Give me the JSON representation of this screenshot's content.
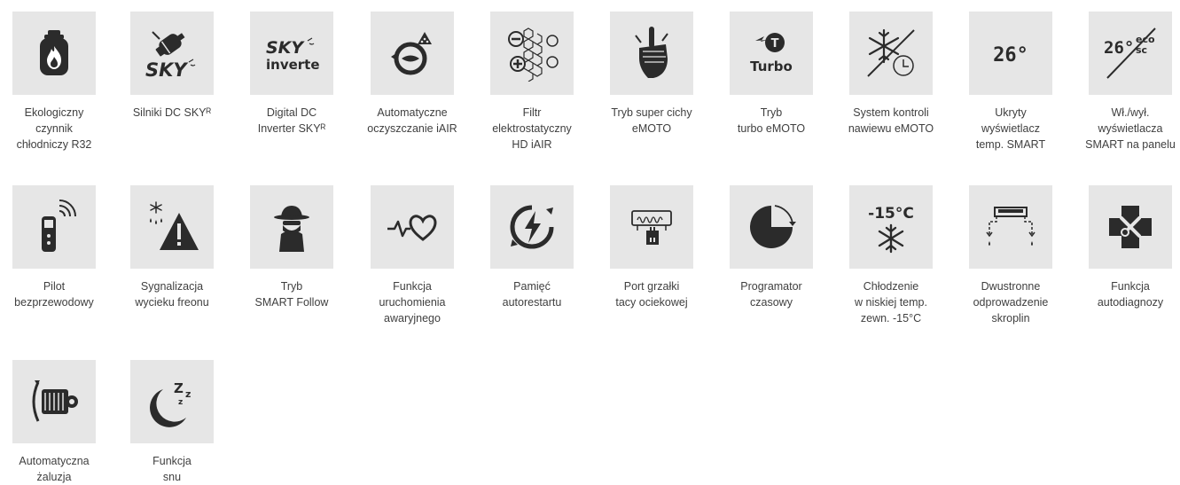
{
  "features": [
    {
      "icon": "gas-cylinder-flame-icon",
      "lines": [
        "Ekologiczny",
        "czynnik",
        "chłodniczy R32"
      ]
    },
    {
      "icon": "sky-dc-motor-icon",
      "lines": [
        "Silniki DC SKYᴿ"
      ],
      "icon_text": "SKY"
    },
    {
      "icon": "sky-inverter-icon",
      "lines": [
        "Digital DC",
        "Inverter SKYᴿ"
      ],
      "icon_text_1": "SKY",
      "icon_text_2": "inverter"
    },
    {
      "icon": "iair-self-cleaning-icon",
      "lines": [
        "Automatyczne",
        "oczyszczanie iAIR"
      ]
    },
    {
      "icon": "electrostatic-filter-icon",
      "lines": [
        "Filtr",
        "elektrostatyczny",
        "HD iAIR"
      ]
    },
    {
      "icon": "silent-hand-icon",
      "lines": [
        "Tryb super cichy",
        "eMOTO"
      ]
    },
    {
      "icon": "turbo-mode-icon",
      "lines": [
        "Tryb",
        "turbo eMOTO"
      ],
      "icon_text_1": "T",
      "icon_text_2": "Turbo"
    },
    {
      "icon": "snowflake-clock-icon",
      "lines": [
        "System kontroli",
        "nawiewu eMOTO"
      ]
    },
    {
      "icon": "hidden-display-icon",
      "lines": [
        "Ukryty",
        "wyświetlacz",
        "temp. SMART"
      ],
      "icon_text": "26°"
    },
    {
      "icon": "display-on-off-icon",
      "lines": [
        "Wł./wył.",
        "wyświetlacza",
        "SMART na panelu"
      ],
      "icon_text_1": "26°",
      "icon_text_2": "eco",
      "icon_text_3": "sc"
    },
    {
      "icon": "wireless-remote-icon",
      "lines": [
        "Pilot",
        "bezprzewodowy"
      ]
    },
    {
      "icon": "refrigerant-leak-warning-icon",
      "lines": [
        "Sygnalizacja",
        "wycieku freonu"
      ]
    },
    {
      "icon": "spy-follow-icon",
      "lines": [
        "Tryb",
        "SMART Follow"
      ]
    },
    {
      "icon": "heartbeat-icon",
      "lines": [
        "Funkcja",
        "uruchomienia",
        "awaryjnego"
      ]
    },
    {
      "icon": "auto-restart-icon",
      "lines": [
        "Pamięć",
        "autorestartu"
      ]
    },
    {
      "icon": "drip-tray-heater-icon",
      "lines": [
        "Port grzałki",
        "tacy ociekowej"
      ]
    },
    {
      "icon": "timer-pie-icon",
      "lines": [
        "Programator",
        "czasowy"
      ]
    },
    {
      "icon": "low-temp-cooling-icon",
      "lines": [
        "Chłodzenie",
        "w niskiej temp.",
        "zewn. -15°C"
      ],
      "icon_text": "-15°C"
    },
    {
      "icon": "dual-drainage-icon",
      "lines": [
        "Dwustronne",
        "odprowadzenie",
        "skroplin"
      ]
    },
    {
      "icon": "self-diagnosis-icon",
      "lines": [
        "Funkcja",
        "autodiagnozy"
      ]
    },
    {
      "icon": "auto-louver-icon",
      "lines": [
        "Automatyczna",
        "żaluzja"
      ]
    },
    {
      "icon": "sleep-mode-icon",
      "lines": [
        "Funkcja",
        "snu"
      ],
      "icon_text_1": "Z",
      "icon_text_2": "z",
      "icon_text_3": "z"
    }
  ]
}
